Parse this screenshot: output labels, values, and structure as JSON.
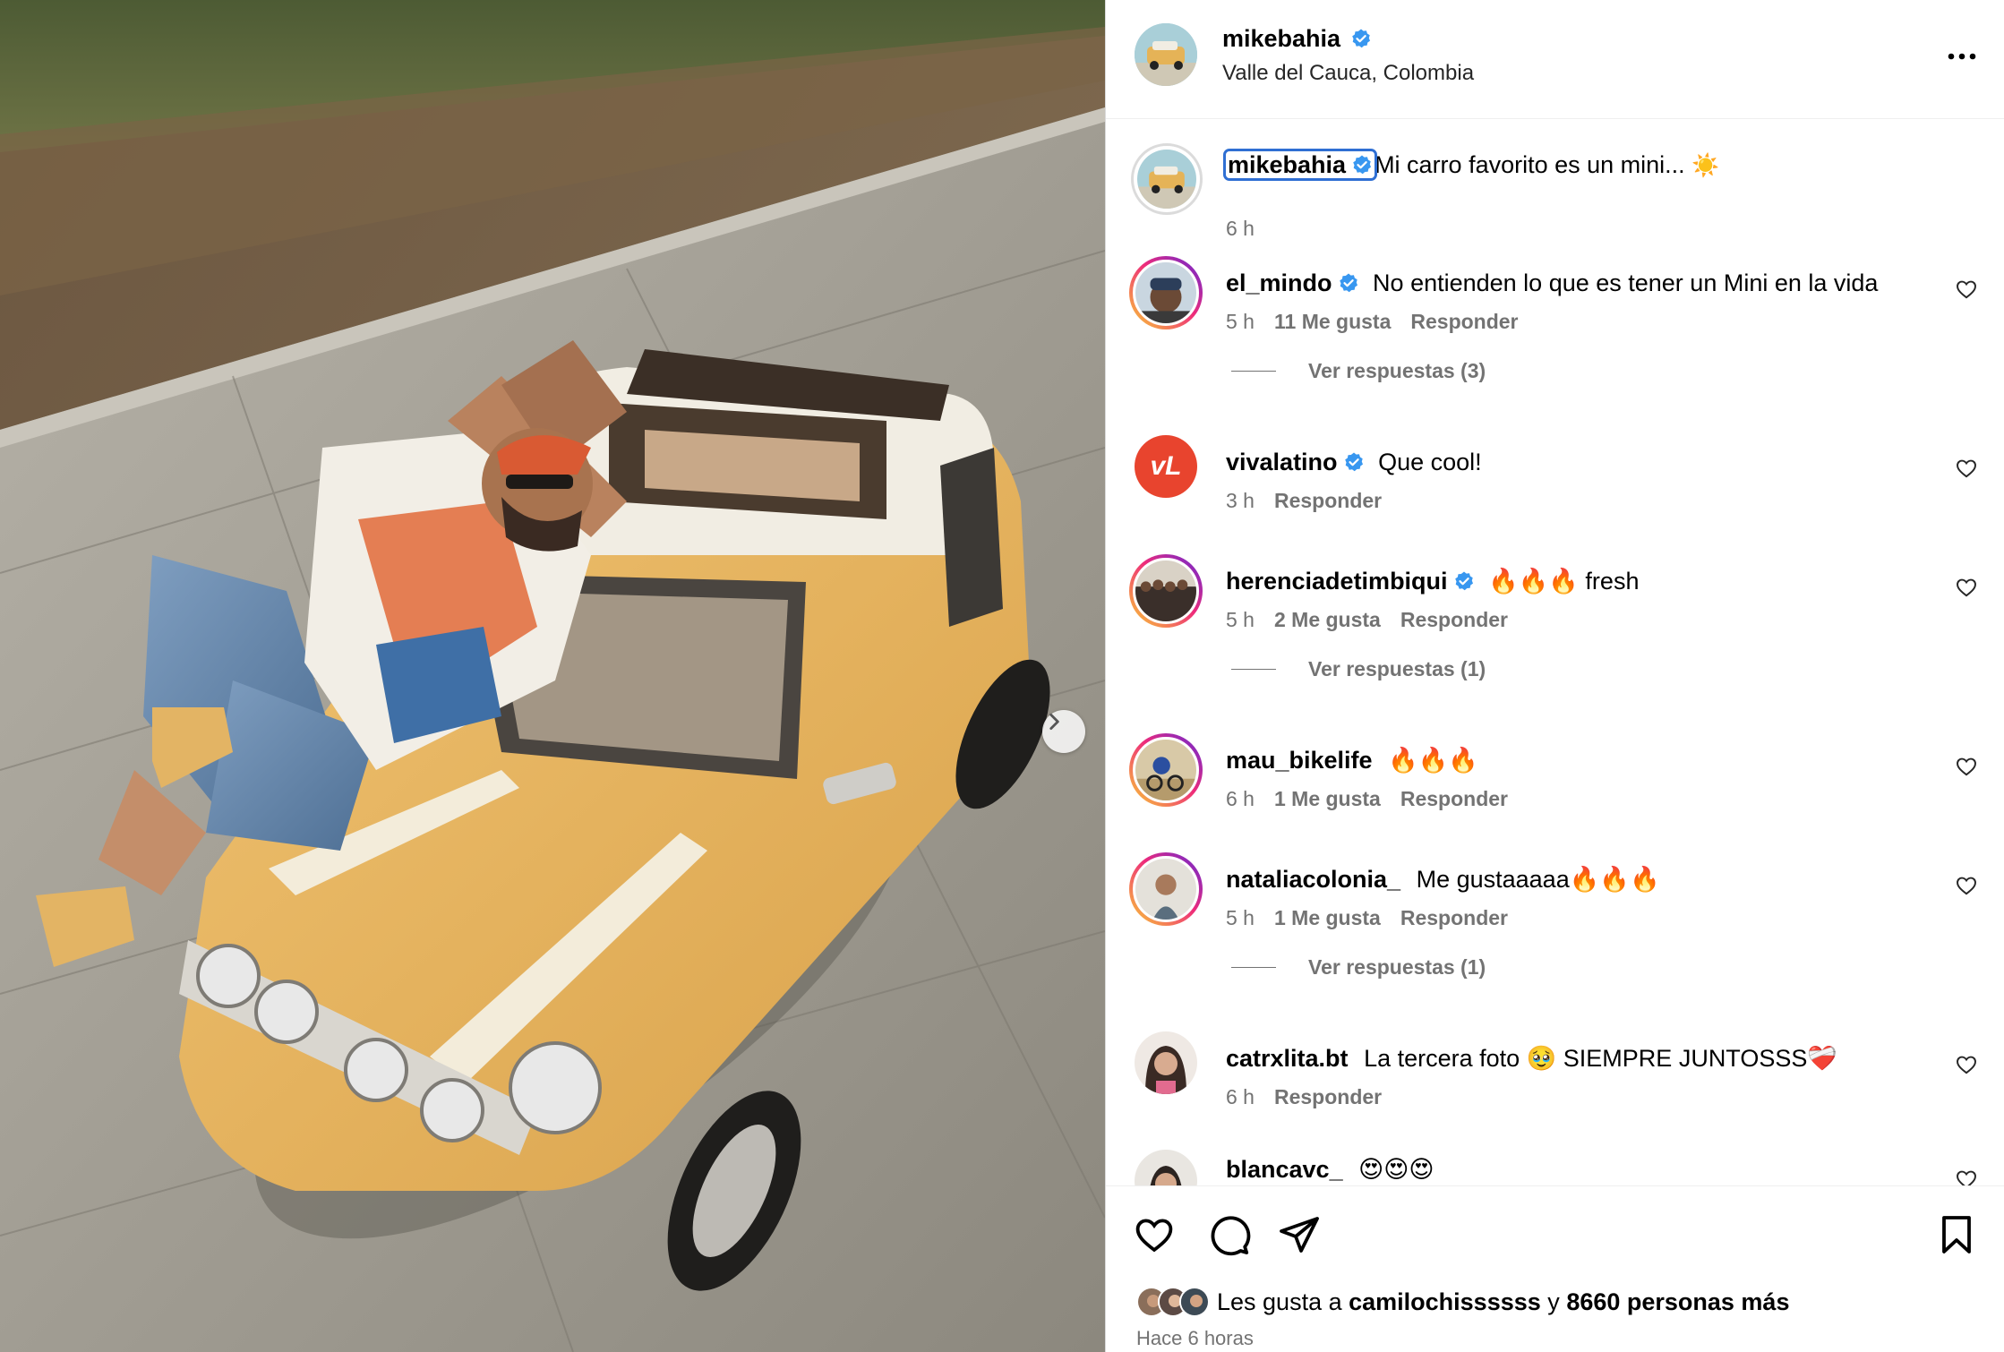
{
  "post": {
    "author": "mikebahia",
    "location": "Valle del Cauca, Colombia",
    "caption_text": "Mi carro favorito es un mini...",
    "caption_emoji": "☀️",
    "caption_time": "6 h"
  },
  "comments": [
    {
      "user": "el_mindo",
      "verified": true,
      "text": "No entienden lo que es tener un Mini en la vida",
      "time": "5 h",
      "likes": "11 Me gusta",
      "reply": "Responder",
      "view_replies": "Ver respuestas (3)"
    },
    {
      "user": "vivalatino",
      "verified": true,
      "text": "Que cool!",
      "time": "3 h",
      "reply": "Responder"
    },
    {
      "user": "herenciadetimbiqui",
      "verified": true,
      "text": "🔥🔥🔥 fresh",
      "time": "5 h",
      "likes": "2 Me gusta",
      "reply": "Responder",
      "view_replies": "Ver respuestas (1)"
    },
    {
      "user": "mau_bikelife",
      "verified": false,
      "text": "🔥🔥🔥",
      "time": "6 h",
      "likes": "1 Me gusta",
      "reply": "Responder"
    },
    {
      "user": "nataliacolonia_",
      "verified": false,
      "text": "Me gustaaaaa🔥🔥🔥",
      "time": "5 h",
      "likes": "1 Me gusta",
      "reply": "Responder",
      "view_replies": "Ver respuestas (1)"
    },
    {
      "user": "catrxlita.bt",
      "verified": false,
      "text": "La tercera foto 🥹 SIEMPRE JUNTOSSS❤️‍🩹",
      "time": "6 h",
      "reply": "Responder"
    },
    {
      "user": "blancavc_",
      "verified": false,
      "text": "😍😍😍"
    }
  ],
  "likes": {
    "prefix": "Les gusta a",
    "first_user": "camilochissssss",
    "joiner": "y",
    "others": "8660 personas más"
  },
  "time_ago": "Hace 6 horas",
  "icons": {
    "verified": "verified-badge-icon",
    "more": "more-options-icon",
    "like": "heart-icon",
    "comment": "comment-icon",
    "share": "share-icon",
    "save": "bookmark-icon",
    "next": "chevron-right-icon"
  },
  "colors": {
    "verified_blue": "#3897f0",
    "meta_gray": "#737373",
    "vivalatino_red": "#e8442e",
    "car_yellow": "#e9b65a"
  }
}
